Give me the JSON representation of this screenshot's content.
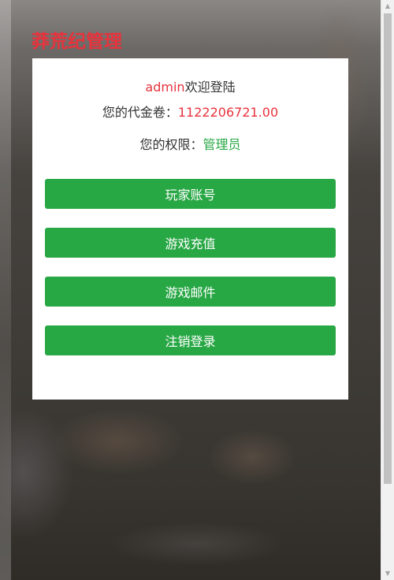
{
  "brand": {
    "title": "莽荒纪管理"
  },
  "welcome": {
    "username": "admin",
    "suffix": "欢迎登陆"
  },
  "voucher": {
    "label": "您的代金卷：",
    "value": "1122206721.00"
  },
  "permission": {
    "label": "您的权限：",
    "value": "管理员"
  },
  "buttons": {
    "player_account": "玩家账号",
    "game_recharge": "游戏充值",
    "game_mail": "游戏邮件",
    "logout": "注销登录"
  },
  "colors": {
    "brand": "#e8323c",
    "accent_green": "#28a745",
    "text": "#333333"
  }
}
